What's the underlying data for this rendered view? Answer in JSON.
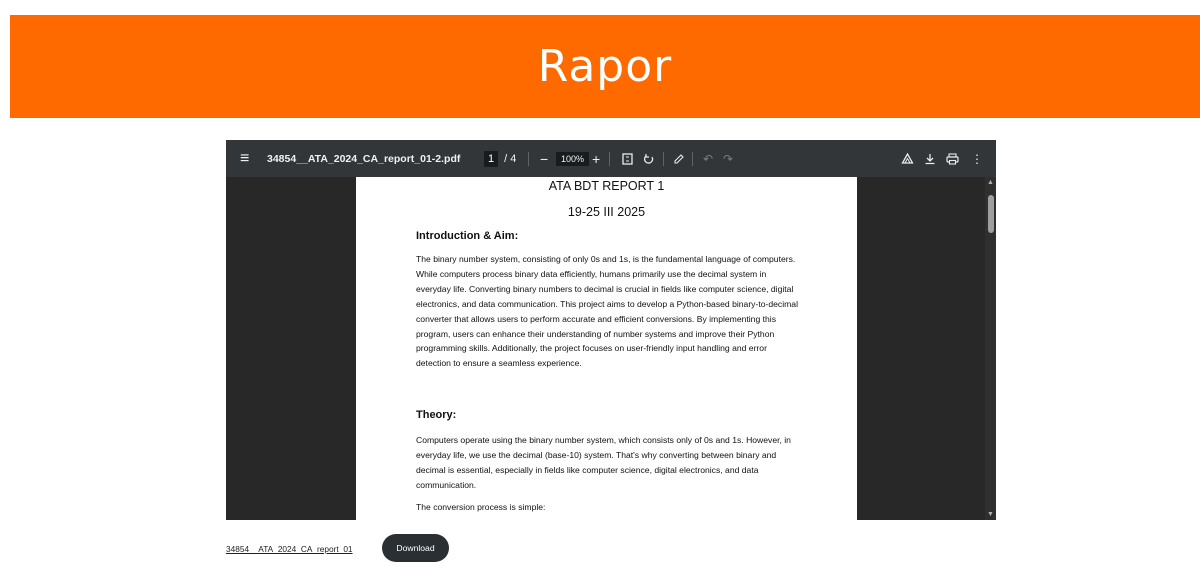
{
  "banner": {
    "title": "Rapor"
  },
  "viewer": {
    "filename": "34854__ATA_2024_CA_report_01-2.pdf",
    "page_current": "1",
    "page_total": "/ 4",
    "zoom": "100%",
    "icons": {
      "menu": "menu-icon",
      "zoom_out": "minus-icon",
      "zoom_in": "plus-icon",
      "fit": "fit-page-icon",
      "rotate": "rotate-icon",
      "annotate": "pen-icon",
      "undo": "undo-icon",
      "redo": "redo-icon",
      "drive": "drive-icon",
      "download": "download-icon",
      "print": "print-icon",
      "more": "more-vertical-icon"
    }
  },
  "document": {
    "title": "ATA BDT REPORT 1",
    "date": "19-25 III 2025",
    "section1_heading": "Introduction & Aim:",
    "section1_text": "The binary number system, consisting of only 0s and 1s, is the fundamental language of computers. While computers process binary data efficiently, humans primarily use the decimal system in everyday life. Converting binary numbers to decimal is crucial in fields like computer science, digital electronics, and data communication. This project aims to develop a Python-based binary-to-decimal converter that allows users to perform accurate and efficient conversions. By implementing this program, users can enhance their understanding of number systems and improve their Python programming skills. Additionally, the project focuses on user-friendly input handling and error detection to ensure a seamless experience.",
    "section2_heading": "Theory:",
    "section2_text": "Computers operate using the binary number system, which consists only of 0s and 1s. However, in everyday life, we use the decimal (base-10) system. That's why converting between binary and decimal is essential, especially in fields like computer science, digital electronics, and data communication.",
    "section2_text2": "The conversion process is simple:"
  },
  "footer": {
    "file_link": "34854__ATA_2024_CA_report_01",
    "download_label": "Download"
  },
  "colors": {
    "accent": "#ff6a00",
    "toolbar": "#323639",
    "viewer_bg": "#282828",
    "button": "#2a2f33"
  }
}
